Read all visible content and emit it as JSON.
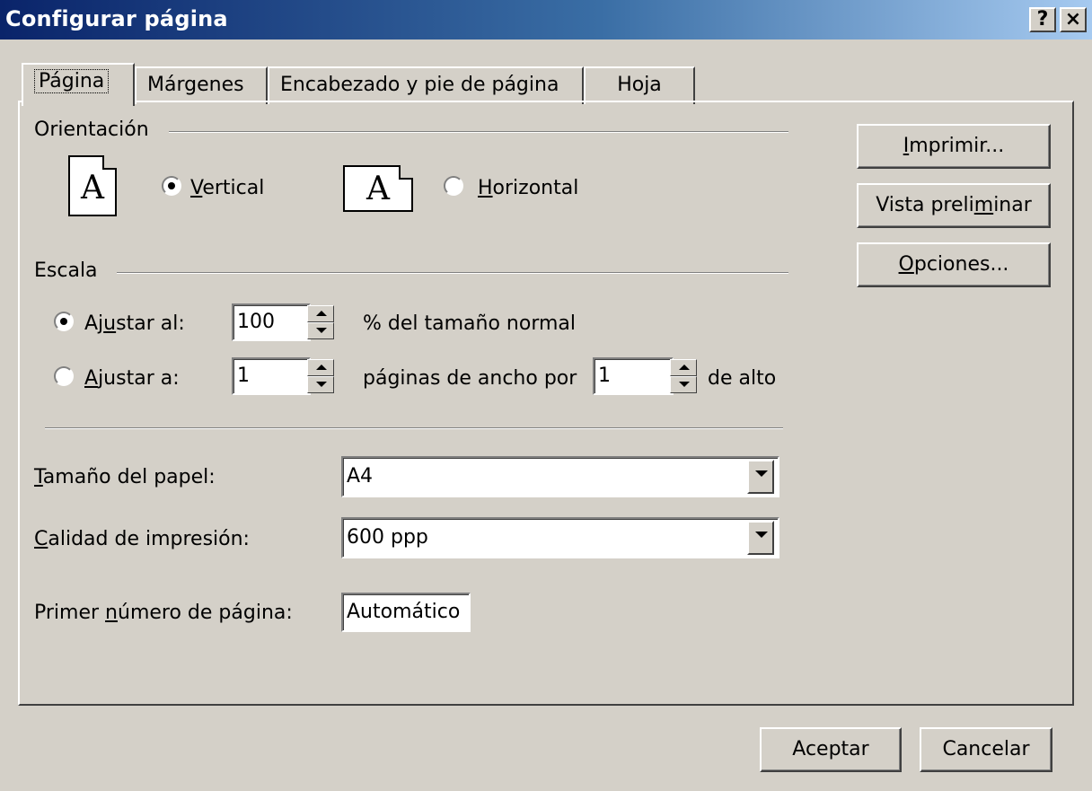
{
  "window": {
    "title": "Configurar página",
    "help_label": "?",
    "close_label": "×"
  },
  "tabs": [
    {
      "label": "Página",
      "active": true
    },
    {
      "label": "Márgenes",
      "active": false
    },
    {
      "label": "Encabezado y pie de página",
      "active": false
    },
    {
      "label": "Hoja",
      "active": false
    }
  ],
  "orientation": {
    "group_label": "Orientación",
    "icon_letter": "A",
    "vertical_label_pre": "",
    "vertical_label_ul": "V",
    "vertical_label_post": "ertical",
    "horizontal_label_pre": "",
    "horizontal_label_ul": "H",
    "horizontal_label_post": "orizontal",
    "selected": "vertical"
  },
  "scale": {
    "group_label": "Escala",
    "adjust_to_label_pre": "Aj",
    "adjust_to_label_ul": "u",
    "adjust_to_label_post": "star al:",
    "adjust_to_value": "100",
    "adjust_to_suffix": "% del tamaño normal",
    "fit_label_pre": "",
    "fit_label_ul": "A",
    "fit_label_post": "justar a:",
    "fit_wide_value": "1",
    "fit_wide_suffix": "páginas de ancho por",
    "fit_tall_value": "1",
    "fit_tall_suffix": "de alto",
    "selected": "adjust_to"
  },
  "paper": {
    "size_label_ul": "T",
    "size_label_post": "amaño del papel:",
    "size_value": "A4",
    "quality_label_ul": "C",
    "quality_label_post": "alidad de impresión:",
    "quality_value": "600 ppp",
    "first_page_label_pre": "Primer ",
    "first_page_label_ul": "n",
    "first_page_label_post": "úmero de página:",
    "first_page_value": "Automático"
  },
  "side_buttons": {
    "print_ul": "I",
    "print_post": "mprimir...",
    "preview_pre": "Vista preli",
    "preview_ul": "m",
    "preview_post": "inar",
    "options_ul": "O",
    "options_post": "pciones..."
  },
  "footer": {
    "ok_label": "Aceptar",
    "cancel_label": "Cancelar"
  }
}
